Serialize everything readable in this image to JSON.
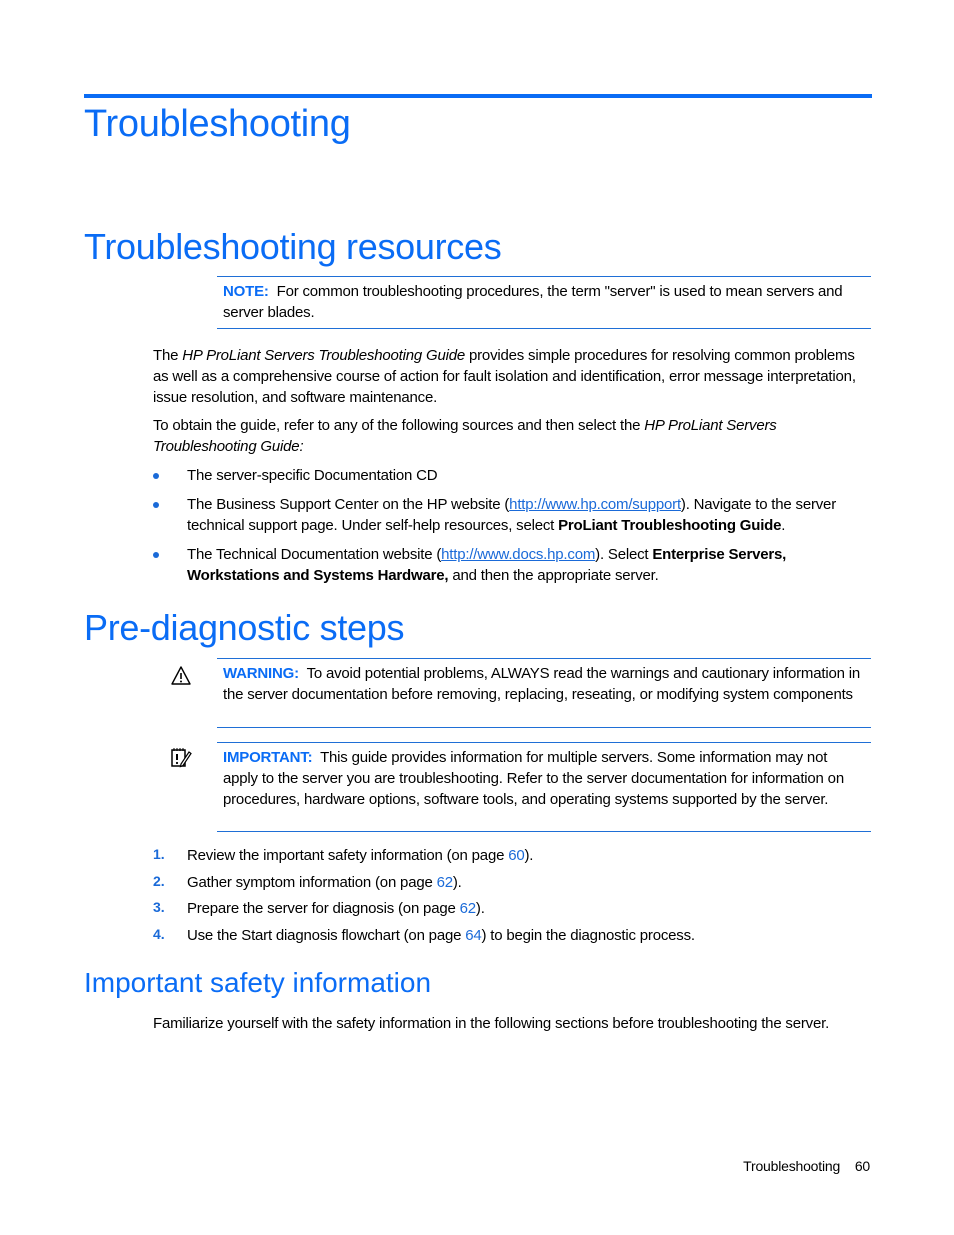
{
  "page": {
    "title": "Troubleshooting",
    "sections": {
      "resources": {
        "heading": "Troubleshooting resources",
        "note": {
          "label": "NOTE:",
          "text": "For common troubleshooting procedures, the term \"server\" is used to mean servers and server blades."
        },
        "para1": {
          "pre": "The ",
          "italic": "HP ProLiant Servers Troubleshooting Guide",
          "post": " provides simple procedures for resolving common problems as well as a comprehensive course of action for fault isolation and identification, error message interpretation, issue resolution, and software maintenance."
        },
        "para2": {
          "pre": "To obtain the guide, refer to any of the following sources and then select the ",
          "italic": "HP ProLiant Servers Troubleshooting Guide:"
        },
        "bullets": [
          {
            "text": "The server-specific Documentation CD"
          },
          {
            "pre": "The Business Support Center on the HP website (",
            "link": "http://www.hp.com/support",
            "mid": "). Navigate to the server technical support page. Under self-help resources, select ",
            "bold": "ProLiant Troubleshooting Guide",
            "post": "."
          },
          {
            "pre": "The Technical Documentation website (",
            "link": "http://www.docs.hp.com",
            "mid": "). Select ",
            "bold": "Enterprise Servers, Workstations and Systems Hardware,",
            "post": " and then the appropriate server."
          }
        ]
      },
      "prediag": {
        "heading": "Pre-diagnostic steps",
        "warning": {
          "icon": "warning-triangle-icon",
          "label": "WARNING:",
          "text": "To avoid potential problems, ALWAYS read the warnings and cautionary information in the server documentation before removing, replacing, reseating, or modifying system components"
        },
        "important": {
          "icon": "notepad-pencil-icon",
          "label": "IMPORTANT:",
          "text": "This guide provides information for multiple servers. Some information may not apply to the server you are troubleshooting. Refer to the server documentation for information on procedures, hardware options, software tools, and operating systems supported by the server."
        },
        "steps": [
          {
            "num": "1.",
            "pre": "Review the important safety information (on page ",
            "page": "60",
            "post": ")."
          },
          {
            "num": "2.",
            "pre": "Gather symptom information (on page ",
            "page": "62",
            "post": ")."
          },
          {
            "num": "3.",
            "pre": "Prepare the server for diagnosis (on page ",
            "page": "62",
            "post": ")."
          },
          {
            "num": "4.",
            "pre": "Use the Start diagnosis flowchart (on page ",
            "page": "64",
            "post": ") to begin the diagnostic process."
          }
        ]
      },
      "safety": {
        "heading": "Important safety information",
        "text": "Familiarize yourself with the safety information in the following sections before troubleshooting the server."
      }
    },
    "footer": {
      "section": "Troubleshooting",
      "page_number": "60"
    },
    "colors": {
      "accent": "#0a6cf5",
      "link": "#1a6ad8"
    }
  }
}
